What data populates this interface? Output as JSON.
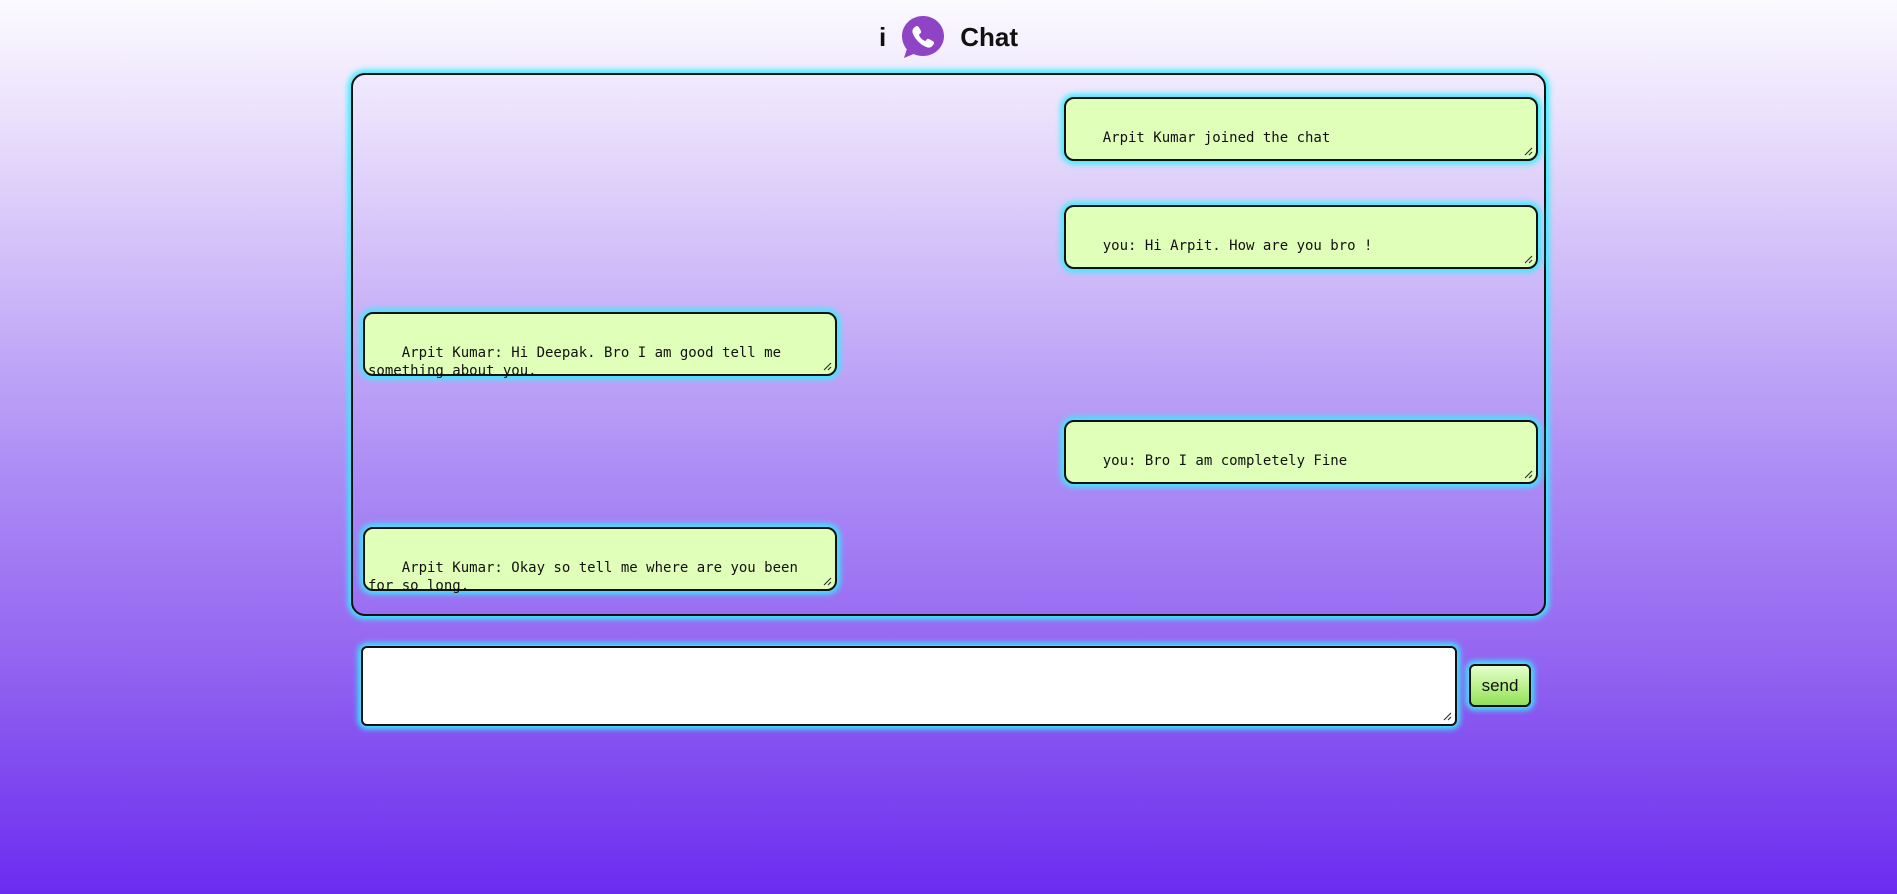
{
  "header": {
    "title_prefix": "i",
    "title_suffix": "Chat",
    "logo_icon": "viber-phone-bubble-icon",
    "logo_color": "#8e44c4"
  },
  "chat": {
    "messages": [
      {
        "side": "right",
        "text": "Arpit Kumar joined the chat"
      },
      {
        "side": "right",
        "text": "you: Hi Arpit. How are you bro !"
      },
      {
        "side": "left",
        "text": "Arpit Kumar: Hi Deepak. Bro I am good tell me something about you."
      },
      {
        "side": "right",
        "text": "you: Bro I am completely Fine"
      },
      {
        "side": "left",
        "text": "Arpit Kumar: Okay so tell me where are you been for so long."
      }
    ]
  },
  "composer": {
    "value": "",
    "placeholder": "",
    "send_label": "send"
  },
  "colors": {
    "message_bg": "#e0ffb8",
    "glow": "#33f0ff",
    "send_button": "#b8f088"
  }
}
